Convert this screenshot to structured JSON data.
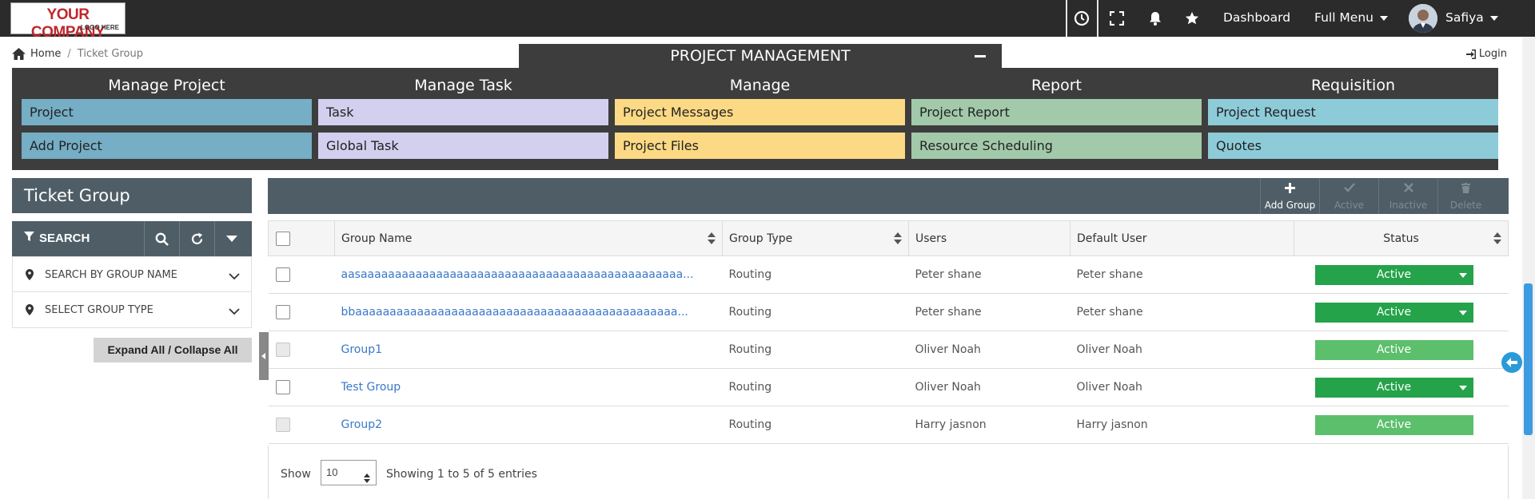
{
  "logo": {
    "line1": "YOUR COMPANY",
    "line2": "LOGO HERE"
  },
  "topbar": {
    "icons": [
      "clock-icon",
      "fullscreen-icon",
      "bell-icon",
      "star-icon"
    ],
    "dashboard": "Dashboard",
    "full_menu": "Full Menu",
    "user": "Safiya"
  },
  "breadcrumb": {
    "home": "Home",
    "separator": "/",
    "current": "Ticket Group"
  },
  "login": "Login",
  "project_panel": {
    "title": "PROJECT MANAGEMENT",
    "columns": [
      {
        "heading": "Manage Project",
        "items": [
          "Project",
          "Add Project"
        ],
        "color": "#75aec5"
      },
      {
        "heading": "Manage Task",
        "items": [
          "Task",
          "Global Task"
        ],
        "color": "#d3cfef"
      },
      {
        "heading": "Manage",
        "items": [
          "Project Messages",
          "Project Files"
        ],
        "color": "#fcd984"
      },
      {
        "heading": "Report",
        "items": [
          "Project Report",
          "Resource Scheduling"
        ],
        "color": "#a2c9aa"
      },
      {
        "heading": "Requisition",
        "items": [
          "Project Request",
          "Quotes"
        ],
        "color": "#8dcbd9"
      }
    ]
  },
  "left": {
    "title": "Ticket Group",
    "search_label": "SEARCH",
    "filters": [
      "SEARCH BY GROUP NAME",
      "SELECT GROUP TYPE"
    ],
    "expand_label": "Expand All / Collapse All"
  },
  "actions": [
    {
      "label": "Add Group",
      "icon": "plus-icon",
      "enabled": true
    },
    {
      "label": "Active",
      "icon": "check-icon",
      "enabled": false
    },
    {
      "label": "Inactive",
      "icon": "x-icon",
      "enabled": false
    },
    {
      "label": "Delete",
      "icon": "trash-icon",
      "enabled": false
    }
  ],
  "table": {
    "headers": [
      "Group Name",
      "Group Type",
      "Users",
      "Default User",
      "Status"
    ],
    "rows": [
      {
        "name": "aasaaaaaaaaaaaaaaaaaaaaaaaaaaaaaaaaaaaaaaaaaaaaaaa...",
        "type": "Routing",
        "users": "Peter shane",
        "default_user": "Peter shane",
        "status": "Active",
        "dropdown": true,
        "disabled": false
      },
      {
        "name": "bbaaaaaaaaaaaaaaaaaaaaaaaaaaaaaaaaaaaaaaaaaaaaaaa...",
        "type": "Routing",
        "users": "Peter shane",
        "default_user": "Peter shane",
        "status": "Active",
        "dropdown": true,
        "disabled": false
      },
      {
        "name": "Group1",
        "type": "Routing",
        "users": "Oliver Noah",
        "default_user": "Oliver Noah",
        "status": "Active",
        "dropdown": false,
        "disabled": true
      },
      {
        "name": "Test Group",
        "type": "Routing",
        "users": "Oliver Noah",
        "default_user": "Oliver Noah",
        "status": "Active",
        "dropdown": true,
        "disabled": false
      },
      {
        "name": "Group2",
        "type": "Routing",
        "users": "Harry jasnon",
        "default_user": "Harry jasnon",
        "status": "Active",
        "dropdown": false,
        "disabled": true
      }
    ]
  },
  "footer": {
    "show": "Show",
    "page_size": "10",
    "info": "Showing 1 to 5 of 5 entries"
  },
  "colors": {
    "navbar": "#2b2b2b",
    "panel": "#3d3d3d",
    "header_slate": "#4f5e66",
    "status_green": "#24a34a",
    "status_light": "#5cbf6c",
    "link": "#3a78c8"
  }
}
